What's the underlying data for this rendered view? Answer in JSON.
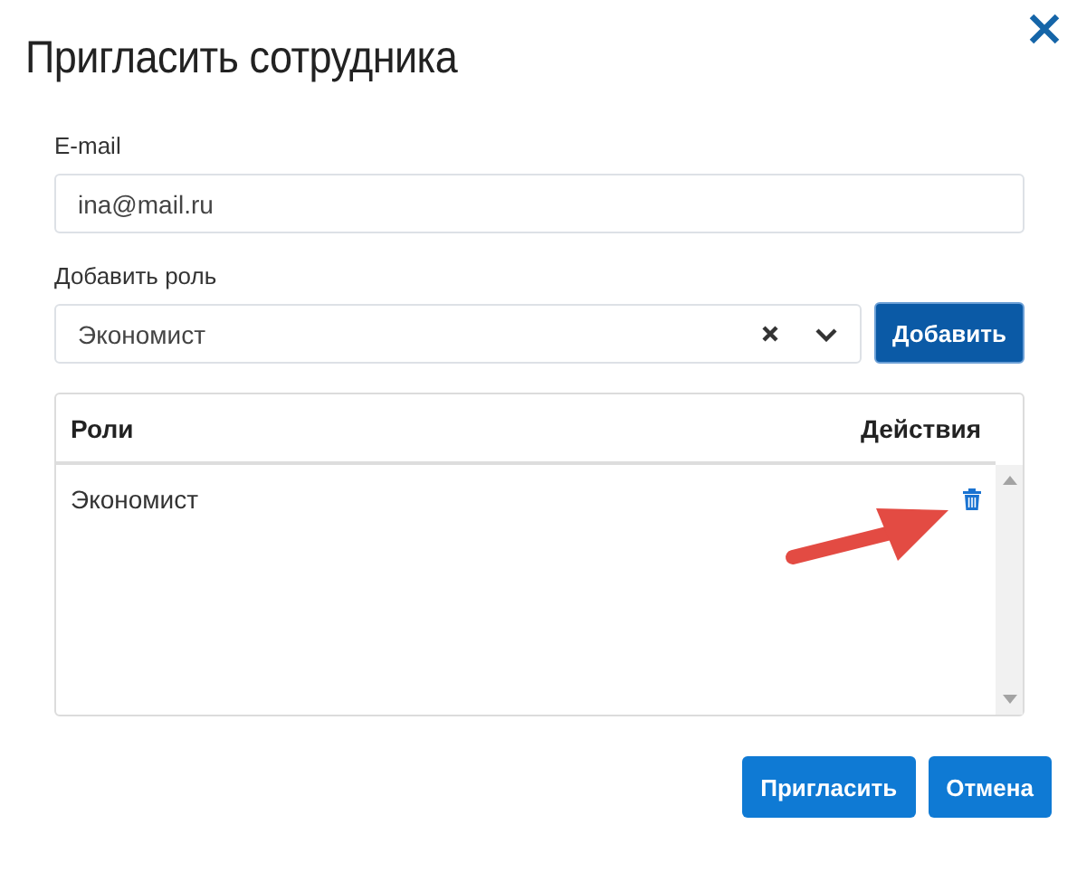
{
  "dialog": {
    "title": "Пригласить сотрудника"
  },
  "email": {
    "label": "E-mail",
    "value": "ina@mail.ru"
  },
  "role_select": {
    "label": "Добавить роль",
    "value": "Экономист",
    "add_button": "Добавить",
    "expanded": false
  },
  "table": {
    "columns": [
      "Роли",
      "Действия"
    ],
    "rows": [
      {
        "role": "Экономист"
      }
    ]
  },
  "buttons": [
    {
      "label": "Пригласить"
    },
    {
      "label": "Отмена"
    }
  ]
}
